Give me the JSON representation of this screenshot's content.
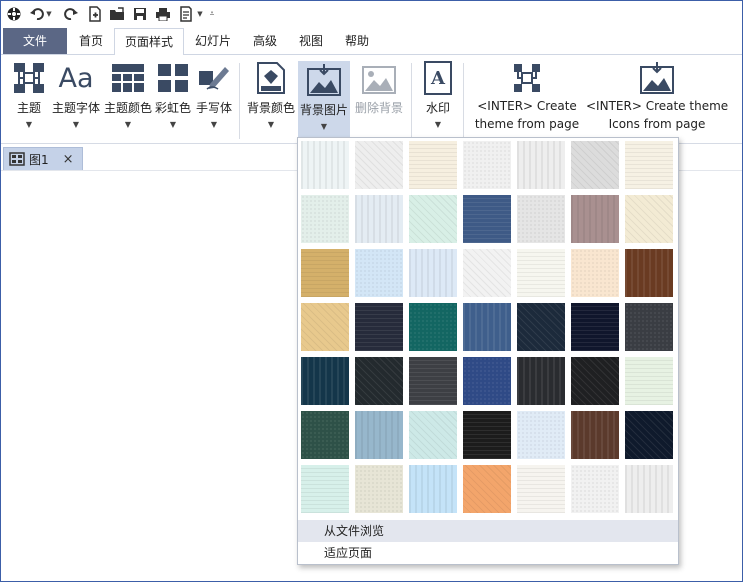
{
  "menu_tabs": [
    {
      "label": "文件"
    },
    {
      "label": "首页"
    },
    {
      "label": "页面样式"
    },
    {
      "label": "幻灯片"
    },
    {
      "label": "高级"
    },
    {
      "label": "视图"
    },
    {
      "label": "帮助"
    }
  ],
  "ribbon": {
    "theme": "主题",
    "theme_font": "主题字体",
    "theme_color": "主题颜色",
    "rainbow_color": "彩虹色",
    "handwriting": "手写体",
    "bg_color": "背景颜色",
    "bg_image": "背景图片",
    "remove_bg": "删除背景",
    "watermark": "水印",
    "watermark_glyph": "A",
    "font_glyph": "Aa",
    "inter_create_theme_line1": "<INTER> Create",
    "inter_create_theme_line2": "theme from page",
    "inter_create_icons_line1": "<INTER> Create theme",
    "inter_create_icons_line2": "Icons from page"
  },
  "document_tab": {
    "label": "图1",
    "close": "×"
  },
  "dropdown": {
    "browse_from_file": "从文件浏览",
    "fit_page": "适应页面",
    "tiles": [
      "#eef4f5",
      "#eeeeee",
      "#f6efe0",
      "#f0f0f0",
      "#eeeeee",
      "#dcdcdc",
      "#f6f1e4",
      "#e3efea",
      "#e4ecf3",
      "#d8efe6",
      "#3e5a86",
      "#e5e5e5",
      "#a99090",
      "#f3ebd4",
      "#d4b06a",
      "#d3e6f6",
      "#dde9f6",
      "#f2f2f2",
      "#f6f6ef",
      "#f9e6d0",
      "#6a3b22",
      "#e8c98d",
      "#262b3b",
      "#136662",
      "#3f5f8c",
      "#1c2a3b",
      "#10162c",
      "#3a3d43",
      "#14364a",
      "#232a2e",
      "#3d3f44",
      "#2f4a86",
      "#2a2c30",
      "#1f2022",
      "#e7f2e3",
      "#2e5148",
      "#97b7cc",
      "#cde9e7",
      "#1c1c1c",
      "#e0ebf6",
      "#5b3a2c",
      "#0f1a2c",
      "#d7f0ea",
      "#e7e5d6",
      "#c4e3f8",
      "#f3a56b",
      "#f6f4ef",
      "#f1f1f1",
      "#eeeeee"
    ]
  },
  "colors": {
    "border": "#3c5ea8",
    "file_tab_bg": "#5b6785",
    "selected_bg": "#cdd8ea"
  }
}
